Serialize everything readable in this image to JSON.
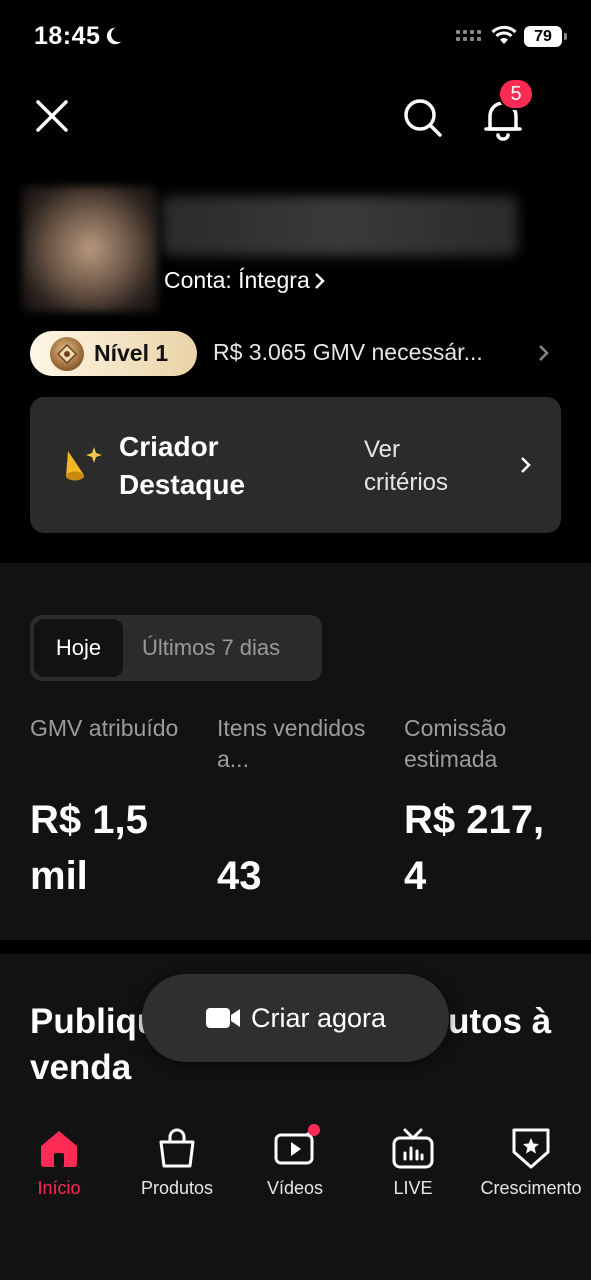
{
  "status_bar": {
    "time": "18:45",
    "battery": "79"
  },
  "header": {
    "notification_count": "5"
  },
  "profile": {
    "account_label": "Conta: Íntegra"
  },
  "level": {
    "label": "Nível 1",
    "gmv_needed": "R$ 3.065 GMV necessár..."
  },
  "creator_card": {
    "title": "Criador Destaque",
    "criteria": "Ver critérios"
  },
  "stats": {
    "tabs": [
      "Hoje",
      "Últimos 7 dias"
    ],
    "selected_tab": "Hoje",
    "items": [
      {
        "label": "GMV atribuído",
        "value": "R$ 1,5 mil"
      },
      {
        "label": "Itens vendidos a...",
        "value": "43"
      },
      {
        "label": "Comissão estimada",
        "value": "R$ 217, 4"
      }
    ]
  },
  "publish": {
    "text": "Publique vídeo com produtos à venda",
    "create_button": "Criar agora"
  },
  "bottom_nav": {
    "items": [
      {
        "label": "Início",
        "icon": "home-icon",
        "active": true
      },
      {
        "label": "Produtos",
        "icon": "bag-icon"
      },
      {
        "label": "Vídeos",
        "icon": "video-icon"
      },
      {
        "label": "LIVE",
        "icon": "live-tv-icon"
      },
      {
        "label": "Crescimento",
        "icon": "growth-badge-icon"
      }
    ]
  },
  "colors": {
    "accent": "#fe2c55",
    "card": "#2b2b2b",
    "section": "#121212"
  }
}
